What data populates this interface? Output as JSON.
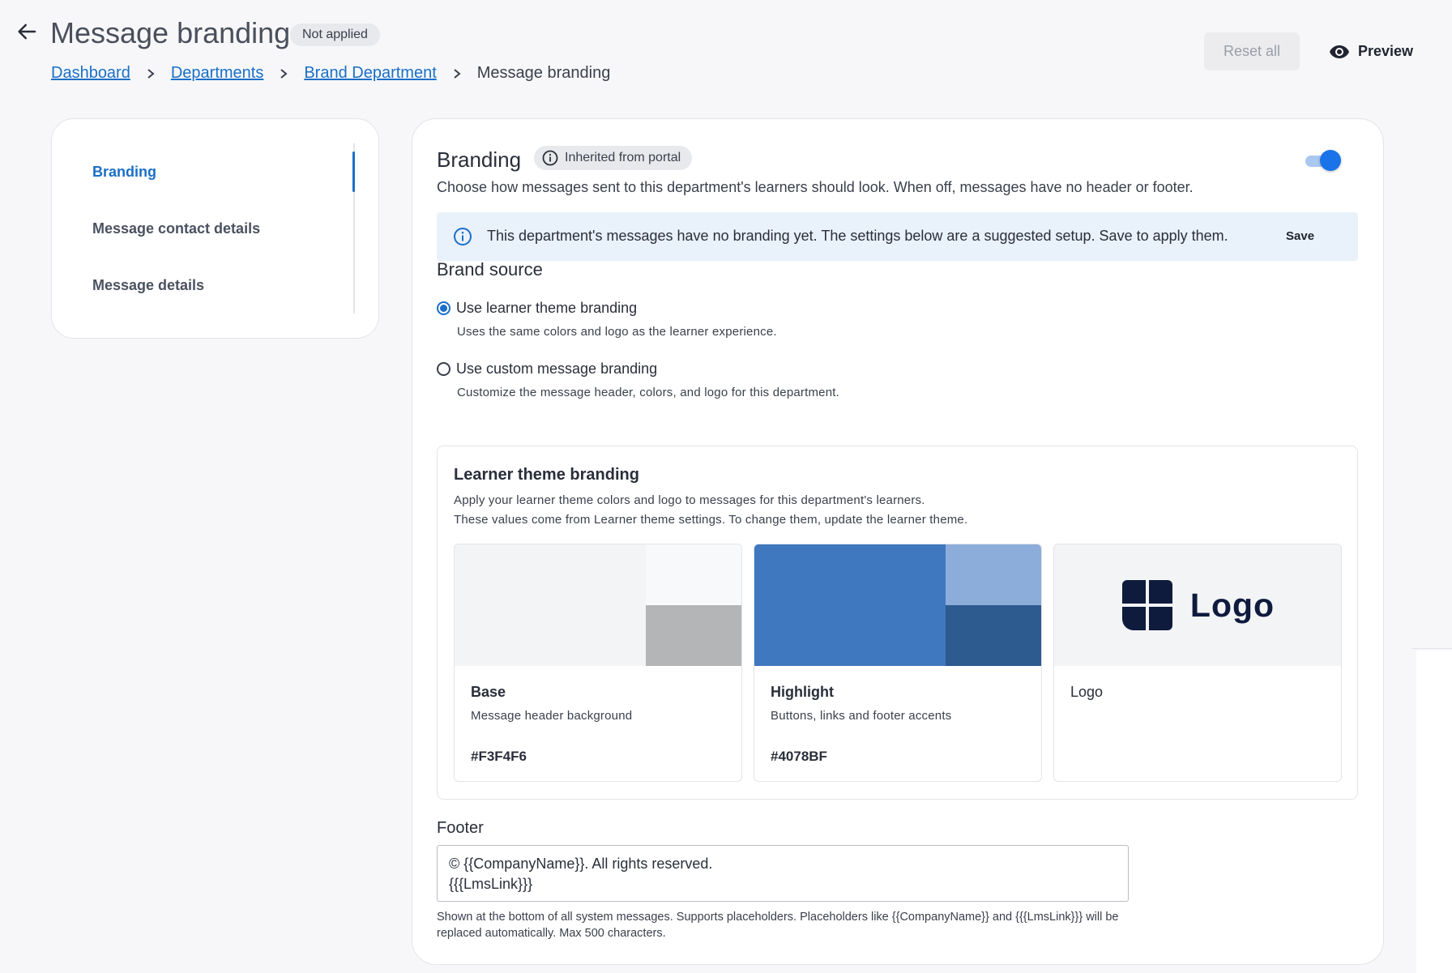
{
  "header": {
    "title": "Message branding",
    "status_chip": "Not applied",
    "breadcrumb": [
      "Dashboard",
      "Departments",
      "Brand Department"
    ],
    "breadcrumb_current": "Message branding",
    "reset_label": "Reset all",
    "preview_label": "Preview",
    "icons": {
      "back": "arrow-left-icon",
      "separator": "chevron-right-icon",
      "preview": "eye-icon"
    }
  },
  "sidebar": {
    "items": [
      {
        "label": "Branding",
        "active": true
      },
      {
        "label": "Message contact details",
        "active": false
      },
      {
        "label": "Message details",
        "active": false
      }
    ]
  },
  "branding": {
    "title": "Branding",
    "inherited_chip": "Inherited from portal",
    "toggle_on": true,
    "description": "Choose how messages sent to this department's learners should look. When off, messages have no header or footer.",
    "banner_text": "This department's messages have no branding yet. The settings below are a suggested setup. Save to apply them.",
    "banner_save": "Save"
  },
  "brand_source": {
    "title": "Brand source",
    "options": [
      {
        "label": "Use learner theme branding",
        "description": "Uses the same colors and logo as the learner experience.",
        "selected": true
      },
      {
        "label": "Use custom message branding",
        "description": "Customize the message header, colors, and logo for this department.",
        "selected": false
      }
    ]
  },
  "learner_theme": {
    "title": "Learner theme branding",
    "description_1": "Apply your learner theme colors and logo to messages for this department's learners.",
    "description_2": "These values come from Learner theme settings. To change them, update the learner theme.",
    "cards": [
      {
        "name": "Base",
        "subtitle": "Message header background",
        "hex": "#F3F4F6",
        "colors": {
          "main": "#F3F4F6",
          "light": "#F8F9FA",
          "dark": "#B4B5B7"
        }
      },
      {
        "name": "Highlight",
        "subtitle": "Buttons, links and footer accents",
        "hex": "#4078BF",
        "colors": {
          "main": "#4078BF",
          "light": "#8CADD9",
          "dark": "#2D5A8F"
        }
      },
      {
        "name": "Logo",
        "subtitle": "",
        "hex": "",
        "logo_text": "Logo",
        "logo_color": "#0F1B3D"
      }
    ]
  },
  "footer": {
    "label": "Footer",
    "value": "© {{CompanyName}}. All rights reserved.\n{{{LmsLink}}}",
    "help": "Shown at the bottom of all system messages. Supports placeholders. Placeholders like {{CompanyName}} and {{{LmsLink}}} will be replaced automatically. Max 500 characters."
  },
  "colors": {
    "accent": "#1A6FC7",
    "banner_bg": "#E9F1FB"
  }
}
